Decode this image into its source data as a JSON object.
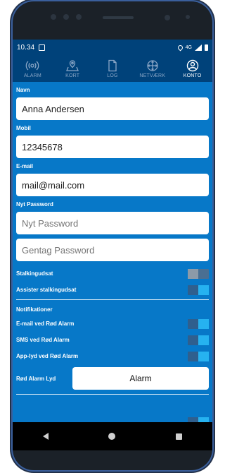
{
  "status_bar": {
    "time": "10.34",
    "network": "4G"
  },
  "nav": {
    "items": [
      {
        "label": "ALARM",
        "icon": "alarm-broadcast-icon",
        "active": false
      },
      {
        "label": "KORT",
        "icon": "map-pin-icon",
        "active": false
      },
      {
        "label": "LOG",
        "icon": "document-icon",
        "active": false
      },
      {
        "label": "NETVÆRK",
        "icon": "network-icon",
        "active": false
      },
      {
        "label": "KONTO",
        "icon": "account-icon",
        "active": true
      }
    ]
  },
  "form": {
    "name_label": "Navn",
    "name_value": "Anna Andersen",
    "mobile_label": "Mobil",
    "mobile_value": "12345678",
    "email_label": "E-mail",
    "email_value": "mail@mail.com",
    "password_label": "Nyt Password",
    "password_placeholder": "Nyt Password",
    "password_repeat_placeholder": "Gentag Password"
  },
  "settings": {
    "stalking_label": "Stalkingudsat",
    "stalking_on": false,
    "assist_stalking_label": "Assister stalkingudsat",
    "assist_stalking_on": true
  },
  "notifications": {
    "title": "Notifikationer",
    "items": [
      {
        "label": "E-mail ved Rød Alarm",
        "on": true
      },
      {
        "label": "SMS ved Rød Alarm",
        "on": true
      },
      {
        "label": "App-lyd ved Rød Alarm",
        "on": true
      }
    ],
    "sound_label": "Rød Alarm Lyd",
    "sound_value": "Alarm"
  },
  "colors": {
    "screen_bg": "#0778c8",
    "nav_bg": "#00427a",
    "toggle_on": "#26b2f0",
    "toggle_off": "#8c9aa8"
  }
}
